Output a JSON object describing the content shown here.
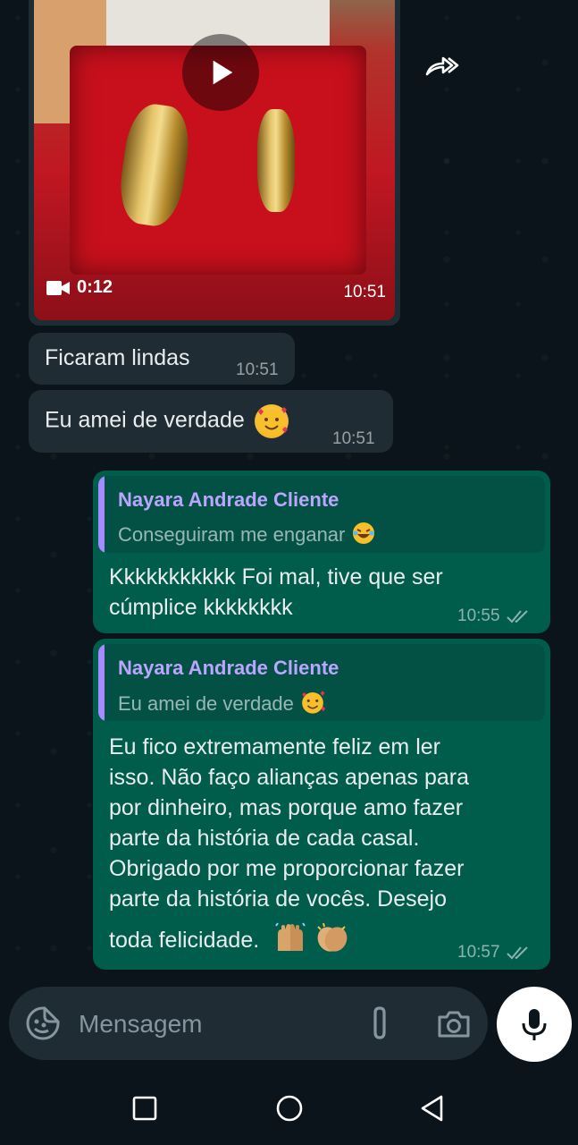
{
  "video": {
    "duration": "0:12",
    "time": "10:51"
  },
  "incoming": [
    {
      "text": "Ficaram lindas",
      "time": "10:51"
    },
    {
      "text": "Eu amei de verdade",
      "time": "10:51"
    }
  ],
  "outgoing": [
    {
      "quote_name": "Nayara Andrade Cliente",
      "quote_text": "Conseguiram me enganar",
      "lines": [
        "Kkkkkkkkkkk Foi mal, tive que ser",
        "cúmplice kkkkkkkk"
      ],
      "time": "10:55"
    },
    {
      "quote_name": "Nayara Andrade Cliente",
      "quote_text": "Eu amei de verdade",
      "lines": [
        "Eu fico extremamente feliz em ler",
        "isso. Não faço alianças apenas para",
        "por dinheiro, mas porque amo fazer",
        "parte da história de cada casal.",
        "Obrigado por me proporcionar fazer",
        "parte da história de vocês. Desejo",
        "toda felicidade."
      ],
      "time": "10:57"
    }
  ],
  "composer": {
    "placeholder": "Mensagem"
  },
  "icons": {
    "play": "play-icon",
    "video": "video-camera-icon",
    "forward": "forward-icon",
    "emoji": "emoji-icon",
    "attach": "paperclip-icon",
    "camera": "camera-icon",
    "mic": "mic-icon",
    "read": "double-check-icon"
  },
  "colors": {
    "background": "#0b141a",
    "incoming_bubble": "#202c33",
    "outgoing_bubble": "#005c4b",
    "quote_name": "#bba6ff",
    "quote_bar": "#a58bff"
  }
}
